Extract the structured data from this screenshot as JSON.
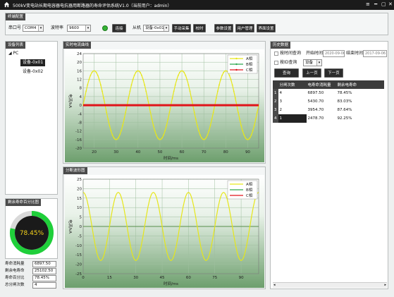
{
  "titlebar": {
    "title": "500kV变电站长期电容器电抗器用断路器的寿命评估系统V1.0（当前用户：admin）",
    "min_glyph": "━",
    "menu_glyph": "≡",
    "restore_glyph": "▢",
    "close_glyph": "✕"
  },
  "settings": {
    "header": "终端配置",
    "port_label": "串口号",
    "port_value": "COM4",
    "baud_label": "波特率",
    "baud_value": "9600",
    "connect": "连接",
    "slave_label": "从机",
    "slave_value": "设备-0x01",
    "manual_collect": "手动采集",
    "time_sync": "校时",
    "param_settings": "参数设置",
    "user_mgmt": "用户管理",
    "ui_settings": "界面设置",
    "status_color": "#35b335"
  },
  "device_list": {
    "header": "设备列表",
    "root": "PC",
    "items": [
      "设备-0x01",
      "设备-0x02"
    ],
    "selected_index": 0
  },
  "life_gauge": {
    "header": "剩余寿命百分比图",
    "percent": 78.45,
    "display": "78.45%",
    "fields": [
      {
        "label": "寿命消耗量",
        "value": "6897.50"
      },
      {
        "label": "剩余电寿命",
        "value": "25102.50"
      },
      {
        "label": "寿命百分比",
        "value": "78.45%"
      },
      {
        "label": "总分闸次数",
        "value": "4"
      }
    ]
  },
  "realtime_chart": {
    "header": "实时电流曲线",
    "ylabel": "电流/kA",
    "xlabel": "时间/ms"
  },
  "trip_chart": {
    "header": "分断波形图",
    "ylabel": "电流/kA",
    "xlabel": "时间/ms"
  },
  "history": {
    "header": "历史数据",
    "by_time": "按时间查询",
    "start_label": "开始时间",
    "start_value": "2020-09-06",
    "end_label": "结束时间",
    "end_value": "2017-09-06",
    "by_id": "按ID查询",
    "id_value": "设备",
    "query": "查询",
    "prev": "上一页",
    "next": "下一页",
    "columns": [
      "分闸次数",
      "电寿命消耗量",
      "剩余电寿命"
    ],
    "rows": [
      {
        "n": "1",
        "count": "4",
        "consumed": "6897.50",
        "remaining": "78.45%"
      },
      {
        "n": "2",
        "count": "3",
        "consumed": "5430.70",
        "remaining": "83.03%"
      },
      {
        "n": "3",
        "count": "2",
        "consumed": "3954.70",
        "remaining": "87.64%"
      },
      {
        "n": "4",
        "count": "1",
        "consumed": "2478.70",
        "remaining": "92.25%"
      }
    ],
    "selected_row": 3
  },
  "chart_data": [
    {
      "type": "line",
      "ylabel": "电流/kA",
      "xlabel": "时间/ms",
      "xlim": [
        15,
        95
      ],
      "ylim": [
        -20,
        24
      ],
      "xticks": [
        20,
        30,
        40,
        50,
        60,
        70,
        80,
        90
      ],
      "yticks": [
        -20,
        -16,
        -12,
        -8,
        -4,
        0,
        4,
        8,
        12,
        16,
        20,
        24
      ],
      "grid": true,
      "legend": "top-right",
      "series": [
        {
          "name": "A相",
          "color": "#e6e61a",
          "amplitude": 16,
          "period_ms": 20,
          "phase_deg": 90
        },
        {
          "name": "B相",
          "color": "#2fa84f",
          "amplitude": 0
        },
        {
          "name": "C相",
          "color": "#e0141a",
          "amplitude": 0
        }
      ]
    },
    {
      "type": "line",
      "ylabel": "电流/kA",
      "xlabel": "时间/ms",
      "xlim": [
        0,
        100
      ],
      "ylim": [
        -25,
        25
      ],
      "xticks": [
        0,
        15,
        30,
        45,
        60,
        75,
        90
      ],
      "yticks": [
        -25,
        -20,
        -15,
        -10,
        -5,
        0,
        5,
        10,
        15,
        20,
        25
      ],
      "grid": true,
      "legend": "top-right",
      "series": [
        {
          "name": "A相",
          "color": "#e6e61a",
          "amplitude": 18,
          "period_ms": 20,
          "phase_deg": 90
        },
        {
          "name": "B相",
          "color": "#2fa84f",
          "amplitude": 0
        },
        {
          "name": "C相",
          "color": "#e0141a",
          "amplitude": 0
        }
      ]
    }
  ]
}
